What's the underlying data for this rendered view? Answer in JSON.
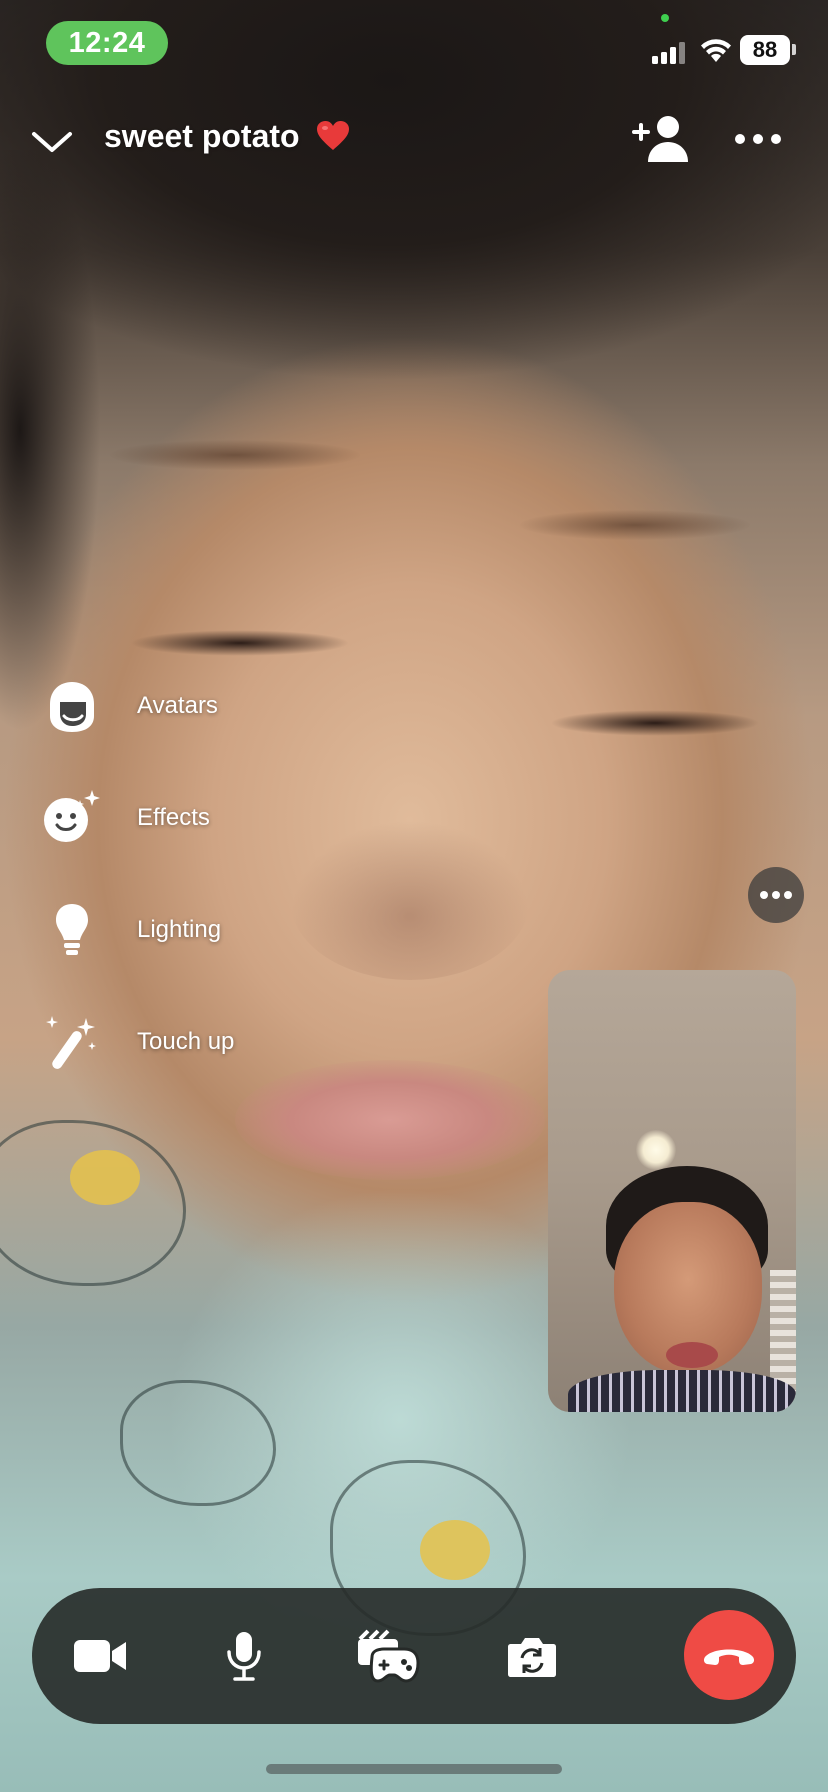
{
  "status_bar": {
    "time": "12:24",
    "battery": "88",
    "colors": {
      "time_pill": "#5fc45c"
    }
  },
  "header": {
    "contact_name": "sweet potato",
    "contact_emoji": "heart-emoji",
    "back_icon": "chevron-down-icon",
    "add_icon": "add-person-icon",
    "more_icon": "more-icon"
  },
  "effects_menu": {
    "items": [
      {
        "label": "Avatars",
        "icon": "avatar-icon"
      },
      {
        "label": "Effects",
        "icon": "sparkle-smiley-icon"
      },
      {
        "label": "Lighting",
        "icon": "lightbulb-icon"
      },
      {
        "label": "Touch up",
        "icon": "magic-wand-icon"
      }
    ]
  },
  "call_controls": {
    "buttons": [
      {
        "name": "camera-button",
        "icon": "video-camera-icon"
      },
      {
        "name": "microphone-button",
        "icon": "microphone-icon"
      },
      {
        "name": "games-button",
        "icon": "game-controller-icon"
      },
      {
        "name": "flip-camera-button",
        "icon": "flip-camera-icon"
      },
      {
        "name": "end-call-button",
        "icon": "hang-up-icon"
      }
    ],
    "colors": {
      "end_call": "#ef4b45"
    }
  }
}
